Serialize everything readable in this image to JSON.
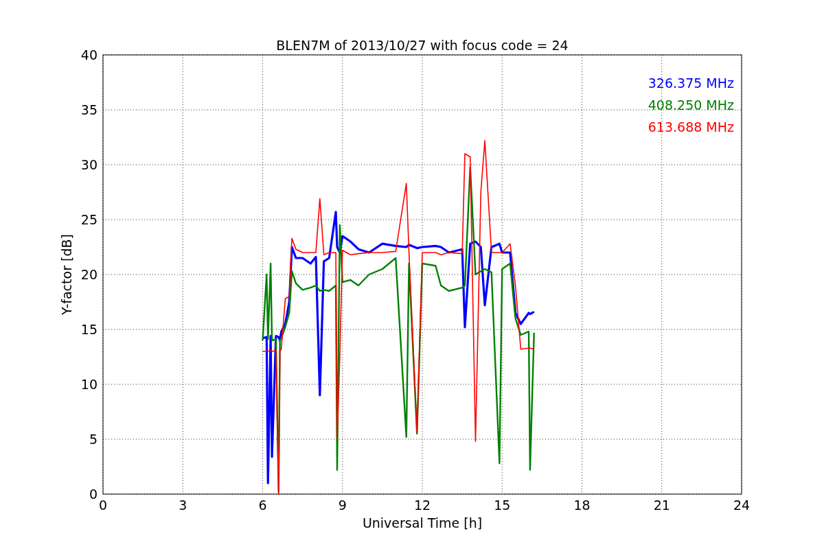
{
  "chart_data": {
    "type": "line",
    "title": "BLEN7M of 2013/10/27 with focus code = 24",
    "xlabel": "Universal Time [h]",
    "ylabel": "Y-factor [dB]",
    "xlim": [
      0,
      24
    ],
    "ylim": [
      0,
      40
    ],
    "xticks": [
      0,
      3,
      6,
      9,
      12,
      15,
      18,
      21,
      24
    ],
    "yticks": [
      0,
      5,
      10,
      15,
      20,
      25,
      30,
      35,
      40
    ],
    "grid": true,
    "x": [
      6.0,
      6.15,
      6.2,
      6.3,
      6.35,
      6.5,
      6.6,
      6.65,
      6.7,
      6.85,
      7.0,
      7.1,
      7.25,
      7.5,
      7.8,
      8.0,
      8.15,
      8.3,
      8.5,
      8.75,
      8.8,
      8.9,
      9.0,
      9.3,
      9.6,
      10.0,
      10.5,
      11.0,
      11.4,
      11.5,
      11.8,
      12.0,
      12.5,
      12.7,
      13.0,
      13.5,
      13.6,
      13.8,
      14.0,
      14.2,
      14.35,
      14.6,
      14.9,
      15.0,
      15.3,
      15.5,
      15.7,
      16.0,
      16.05,
      16.2
    ],
    "series": [
      {
        "name": "326.375 MHz",
        "color": "#0000ff",
        "values": [
          14.2,
          14.3,
          1.0,
          14.4,
          3.4,
          14.4,
          14.3,
          14.0,
          14.8,
          15.5,
          17.5,
          22.5,
          21.5,
          21.5,
          21.0,
          21.6,
          9.0,
          21.2,
          21.5,
          25.7,
          22.5,
          22.0,
          23.5,
          23.0,
          22.3,
          22.0,
          22.8,
          22.6,
          22.5,
          22.7,
          22.4,
          22.5,
          22.6,
          22.5,
          22.0,
          22.3,
          15.2,
          22.8,
          23.0,
          22.5,
          17.2,
          22.5,
          22.8,
          22.0,
          22.0,
          16.5,
          15.5,
          16.5,
          16.4,
          16.6
        ]
      },
      {
        "name": "408.250 MHz",
        "color": "#008000",
        "values": [
          14.0,
          20.0,
          14.1,
          21.0,
          14.0,
          14.1,
          0.2,
          14.0,
          14.2,
          15.2,
          16.5,
          20.3,
          19.2,
          18.6,
          18.8,
          19.0,
          18.5,
          18.6,
          18.5,
          19.0,
          2.2,
          24.5,
          19.3,
          19.5,
          19.0,
          20.0,
          20.5,
          21.5,
          5.2,
          21.0,
          5.5,
          21.0,
          20.8,
          19.0,
          18.5,
          18.8,
          19.0,
          29.8,
          20.0,
          20.3,
          20.5,
          20.2,
          2.8,
          20.5,
          21.0,
          16.0,
          14.5,
          14.8,
          2.2,
          14.7
        ]
      },
      {
        "name": "613.688 MHz",
        "color": "#ff0000",
        "values": [
          13.0,
          13.0,
          13.0,
          13.1,
          13.0,
          13.1,
          0.0,
          13.0,
          13.2,
          17.8,
          18.0,
          23.3,
          22.3,
          22.0,
          22.0,
          22.0,
          26.9,
          21.8,
          22.0,
          22.0,
          5.0,
          12.6,
          22.2,
          21.8,
          21.9,
          22.0,
          22.0,
          22.1,
          28.3,
          22.0,
          5.6,
          22.0,
          22.0,
          21.8,
          22.0,
          21.9,
          31.0,
          30.7,
          4.8,
          27.5,
          32.2,
          22.0,
          22.0,
          22.0,
          22.8,
          19.0,
          13.2,
          13.3,
          13.3,
          13.2
        ]
      }
    ]
  }
}
